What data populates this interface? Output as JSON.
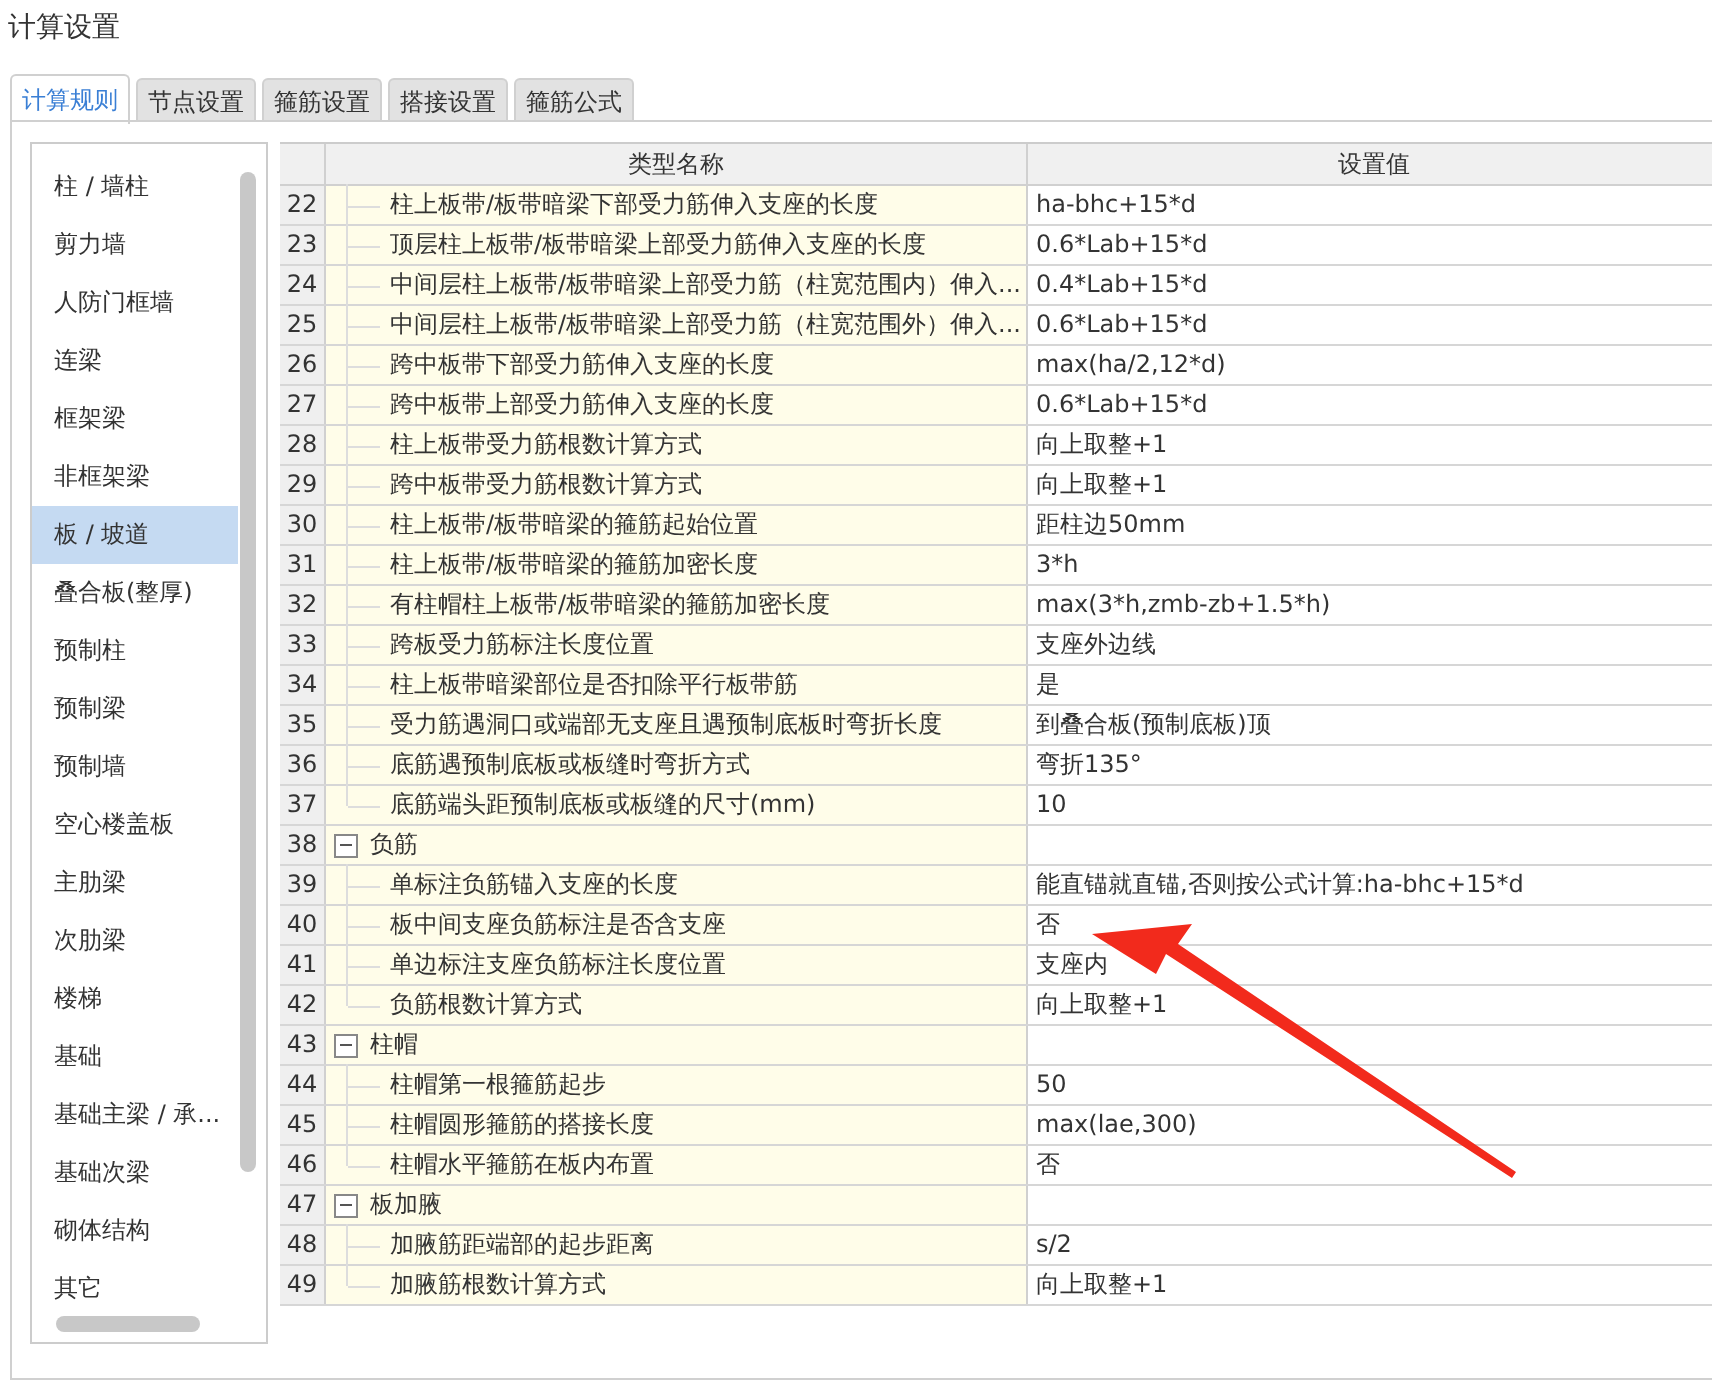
{
  "window": {
    "title": "计算设置"
  },
  "tabs": [
    {
      "label": "计算规则",
      "selected": true
    },
    {
      "label": "节点设置",
      "selected": false
    },
    {
      "label": "箍筋设置",
      "selected": false
    },
    {
      "label": "搭接设置",
      "selected": false
    },
    {
      "label": "箍筋公式",
      "selected": false
    }
  ],
  "sidebar": {
    "items": [
      {
        "label": "柱 / 墙柱",
        "selected": false
      },
      {
        "label": "剪力墙",
        "selected": false
      },
      {
        "label": "人防门框墙",
        "selected": false
      },
      {
        "label": "连梁",
        "selected": false
      },
      {
        "label": "框架梁",
        "selected": false
      },
      {
        "label": "非框架梁",
        "selected": false
      },
      {
        "label": "板 / 坡道",
        "selected": true
      },
      {
        "label": "叠合板(整厚)",
        "selected": false
      },
      {
        "label": "预制柱",
        "selected": false
      },
      {
        "label": "预制梁",
        "selected": false
      },
      {
        "label": "预制墙",
        "selected": false
      },
      {
        "label": "空心楼盖板",
        "selected": false
      },
      {
        "label": "主肋梁",
        "selected": false
      },
      {
        "label": "次肋梁",
        "selected": false
      },
      {
        "label": "楼梯",
        "selected": false
      },
      {
        "label": "基础",
        "selected": false
      },
      {
        "label": "基础主梁 / 承...",
        "selected": false
      },
      {
        "label": "基础次梁",
        "selected": false
      },
      {
        "label": "砌体结构",
        "selected": false
      },
      {
        "label": "其它",
        "selected": false
      }
    ]
  },
  "table": {
    "columns": [
      "类型名称",
      "设置值"
    ],
    "rows": [
      {
        "no": "22",
        "name": "柱上板带/板带暗梁下部受力筋伸入支座的长度",
        "value": "ha-bhc+15*d"
      },
      {
        "no": "23",
        "name": "顶层柱上板带/板带暗梁上部受力筋伸入支座的长度",
        "value": "0.6*Lab+15*d"
      },
      {
        "no": "24",
        "name": "中间层柱上板带/板带暗梁上部受力筋（柱宽范围内）伸入...",
        "value": "0.4*Lab+15*d"
      },
      {
        "no": "25",
        "name": "中间层柱上板带/板带暗梁上部受力筋（柱宽范围外）伸入...",
        "value": "0.6*Lab+15*d"
      },
      {
        "no": "26",
        "name": "跨中板带下部受力筋伸入支座的长度",
        "value": "max(ha/2,12*d)"
      },
      {
        "no": "27",
        "name": "跨中板带上部受力筋伸入支座的长度",
        "value": "0.6*Lab+15*d"
      },
      {
        "no": "28",
        "name": "柱上板带受力筋根数计算方式",
        "value": "向上取整+1"
      },
      {
        "no": "29",
        "name": "跨中板带受力筋根数计算方式",
        "value": "向上取整+1"
      },
      {
        "no": "30",
        "name": "柱上板带/板带暗梁的箍筋起始位置",
        "value": "距柱边50mm"
      },
      {
        "no": "31",
        "name": "柱上板带/板带暗梁的箍筋加密长度",
        "value": "3*h"
      },
      {
        "no": "32",
        "name": "有柱帽柱上板带/板带暗梁的箍筋加密长度",
        "value": "max(3*h,zmb-zb+1.5*h)"
      },
      {
        "no": "33",
        "name": "跨板受力筋标注长度位置",
        "value": "支座外边线"
      },
      {
        "no": "34",
        "name": "柱上板带暗梁部位是否扣除平行板带筋",
        "value": "是"
      },
      {
        "no": "35",
        "name": "受力筋遇洞口或端部无支座且遇预制底板时弯折长度",
        "value": "到叠合板(预制底板)顶"
      },
      {
        "no": "36",
        "name": "底筋遇预制底板或板缝时弯折方式",
        "value": "弯折135°"
      },
      {
        "no": "37",
        "name": "底筋端头距预制底板或板缝的尺寸(mm)",
        "value": "10"
      },
      {
        "no": "38",
        "name": "负筋",
        "expanded": true,
        "children": [
          {
            "no": "39",
            "name": "单标注负筋锚入支座的长度",
            "value": "能直锚就直锚,否则按公式计算:ha-bhc+15*d"
          },
          {
            "no": "40",
            "name": "板中间支座负筋标注是否含支座",
            "value": "否"
          },
          {
            "no": "41",
            "name": "单边标注支座负筋标注长度位置",
            "value": "支座内"
          },
          {
            "no": "42",
            "name": "负筋根数计算方式",
            "value": "向上取整+1"
          }
        ]
      },
      {
        "no": "43",
        "name": "柱帽",
        "expanded": true,
        "children": [
          {
            "no": "44",
            "name": "柱帽第一根箍筋起步",
            "value": "50"
          },
          {
            "no": "45",
            "name": "柱帽圆形箍筋的搭接长度",
            "value": "max(lae,300)"
          },
          {
            "no": "46",
            "name": "柱帽水平箍筋在板内布置",
            "value": "否"
          }
        ]
      },
      {
        "no": "47",
        "name": "板加腋",
        "expanded": true,
        "children": [
          {
            "no": "48",
            "name": "加腋筋距端部的起步距离",
            "value": "s/2"
          },
          {
            "no": "49",
            "name": "加腋筋根数计算方式",
            "value": "向上取整+1"
          }
        ]
      }
    ]
  }
}
